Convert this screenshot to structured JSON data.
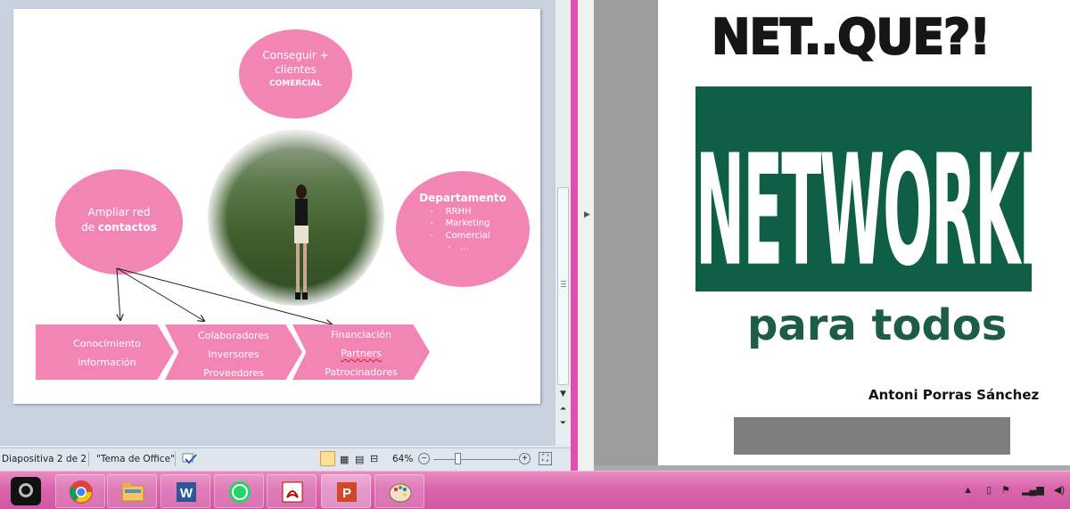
{
  "slide": {
    "top_circle": {
      "line1": "Conseguir +",
      "line2": "clientes",
      "line3": "COMERCIAL"
    },
    "left_circle": {
      "line1": "Ampliar red",
      "line2a": "de ",
      "line2b": "contactos"
    },
    "right_circle": {
      "title": "Departamento",
      "items": [
        "RRHH",
        "Marketing",
        "Comercial",
        "…"
      ],
      "bullet": "-"
    },
    "chevrons": [
      {
        "lines": [
          "Conocimiento",
          "información"
        ]
      },
      {
        "lines": [
          "Colaboradores",
          "Inversores",
          "Proveedores"
        ]
      },
      {
        "lines": [
          "Financiación",
          "Partners",
          "Patrocinadores"
        ]
      }
    ]
  },
  "statusbar": {
    "slide_info": "Diapositiva 2 de 2",
    "theme": "\"Tema de Office\"",
    "zoom": "64%"
  },
  "right_doc": {
    "title": "NET..QUE?!",
    "big_word": "NETWORKING",
    "subtitle": "para todos",
    "author": "Antoni Porras Sánchez"
  },
  "taskbar": {
    "apps": [
      "camera-app",
      "chrome",
      "file-explorer",
      "word",
      "whatsapp",
      "acrobat",
      "powerpoint",
      "paint"
    ]
  },
  "colors": {
    "pink": "#f285b3",
    "green": "#0f5f47",
    "taskbar": "#d964ac"
  }
}
